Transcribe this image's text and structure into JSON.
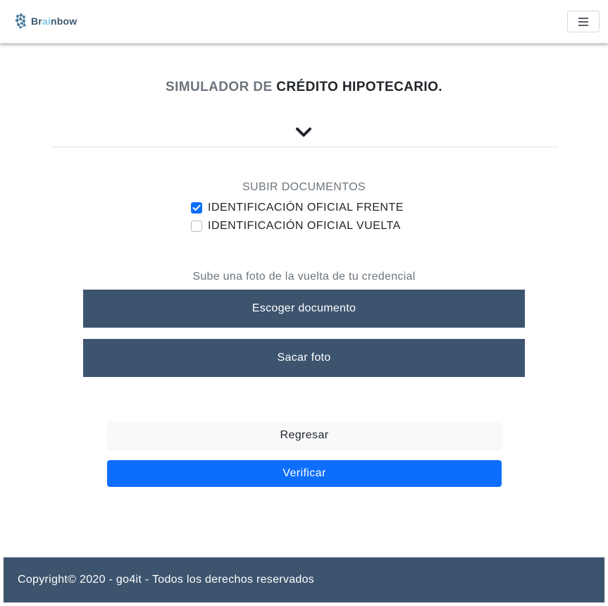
{
  "navbar": {
    "brand": {
      "prefix": "Br",
      "accent": "ai",
      "suffix": "nbow",
      "icon": "brain-icon"
    },
    "menu_icon": "hamburger-icon"
  },
  "header": {
    "title_part1": "SIMULADOR DE",
    "title_part2": "CRÉDITO HIPOTECARIO.",
    "expand_icon": "chevron-down-icon"
  },
  "documents": {
    "heading": "SUBIR DOCUMENTOS",
    "items": [
      {
        "label": "IDENTIFICACIÓN OFICIAL FRENTE",
        "checked": true
      },
      {
        "label": "IDENTIFICACIÓN OFICIAL VUELTA",
        "checked": false
      }
    ]
  },
  "upload": {
    "hint": "Sube una foto de la vuelta de tu credencial",
    "choose_label": "Escoger documento",
    "photo_label": "Sacar foto"
  },
  "actions": {
    "back_label": "Regresar",
    "verify_label": "Verificar"
  },
  "footer": {
    "text": "Copyright© 2020 - go4it - Todos los derechos reservados"
  },
  "colors": {
    "primary": "#0d6efd",
    "dark_slate": "#3d546e",
    "muted": "#6c757d"
  }
}
